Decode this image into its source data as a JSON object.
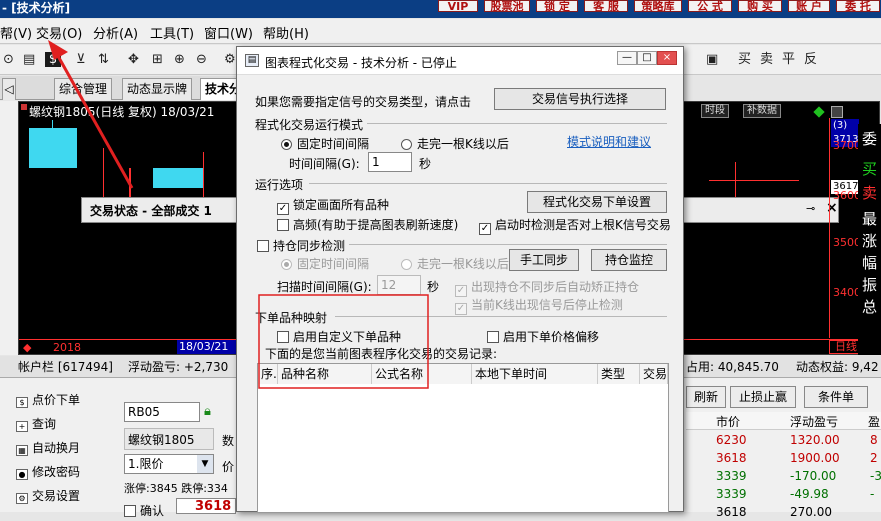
{
  "app": {
    "title": "- [技术分析]",
    "top_buttons": [
      "VIP",
      "股票池",
      "锁 定",
      "客 服",
      "策略库",
      "公 式",
      "购 买",
      "账 户",
      "委 托"
    ]
  },
  "menu": [
    "帮(V)",
    "交易(O)",
    "分析(A)",
    "工具(T)",
    "窗口(W)",
    "帮助(H)"
  ],
  "toolbar_right": [
    "买",
    "卖",
    "平",
    "反"
  ],
  "tabs": [
    "综合管理",
    "动态显示牌",
    "技术分"
  ],
  "chart": {
    "symbol": "螺纹钢1805(日线 复权) 18/03/21",
    "dialog_text": "交易状态 - 全部成交 1",
    "right_prices": [
      "3700",
      "3600",
      "3500",
      "3400"
    ],
    "right_top": [
      "(3)",
      "3713"
    ],
    "marker_price": "3617",
    "time_btn": "时段",
    "data_btn": "补数据",
    "bottom_left": "2018",
    "bottom_date": "18/03/21",
    "bottom_right": "日线",
    "side_chars": [
      "委",
      "买",
      "卖",
      "最",
      "涨",
      "幅",
      "振",
      "总"
    ]
  },
  "account": {
    "label": "帐户栏 [617494]",
    "float_label": "浮动盈亏: +2,730",
    "used": "占用: 40,845.70",
    "equity": "动态权益: 9,42"
  },
  "nav": [
    "点价下单",
    "查询",
    "自动换月",
    "修改密码",
    "交易设置"
  ],
  "order": {
    "code": "RB05",
    "name": "螺纹钢1805",
    "qty_label": "数",
    "type": "1.限价",
    "price_label": "价",
    "limits": "涨停:3845 跌停:334",
    "confirm": "确认",
    "price": "3618"
  },
  "positions": {
    "buttons": [
      "刷新",
      "止损止赢",
      "条件单"
    ],
    "headers": [
      "市价",
      "浮动盈亏",
      "盈"
    ],
    "rows": [
      {
        "price": "6230",
        "pnl": "1320.00",
        "extra": "8",
        "color": "#c00000"
      },
      {
        "price": "3618",
        "pnl": "1900.00",
        "extra": "2",
        "color": "#c00000"
      },
      {
        "price": "3339",
        "pnl": "-170.00",
        "extra": "-3",
        "color": "#007000"
      },
      {
        "price": "3339",
        "pnl": "-49.98",
        "extra": "-",
        "color": "#007000"
      },
      {
        "price": "3618",
        "pnl": "270.00",
        "extra": "",
        "color": "#000000"
      }
    ]
  },
  "dialog": {
    "title": "图表程式化交易 - 技术分析 - 已停止",
    "intro": "如果您需要指定信号的交易类型，请点击",
    "signal_btn": "交易信号执行选择",
    "mode_title": "程式化交易运行模式",
    "mode_fixed": "固定时间间隔",
    "mode_kline": "走完一根K线以后",
    "mode_link": "模式说明和建议",
    "interval_label": "时间间隔(G):",
    "interval_value": "1",
    "sec": "秒",
    "opts_title": "运行选项",
    "lock": "锁定画面所有品种",
    "order_setting_btn": "程式化交易下单设置",
    "hf": "高频(有助于提高图表刷新速度)",
    "check_kline": "启动时检测是否对上根K信号交易",
    "sync_title": "持仓同步检测",
    "sync_fixed": "固定时间间隔",
    "sync_kline": "走完一根K线以后",
    "manual_sync": "手工同步",
    "pos_monitor": "持仓监控",
    "scan_label": "扫描时间间隔(G):",
    "scan_value": "12",
    "scan_sec": "秒",
    "auto_fix": "出现持仓不同步后自动矫正持仓",
    "stop_detect": "当前K线出现信号后停止检测",
    "map_title": "下单品种映射",
    "custom_product": "启用自定义下单品种",
    "price_offset": "启用下单价格偏移",
    "records_label": "下面的是您当前图表程序化交易的交易记录:",
    "table_headers": [
      "序.",
      "品种名称",
      "公式名称",
      "本地下单时间",
      "类型",
      "交易"
    ]
  }
}
